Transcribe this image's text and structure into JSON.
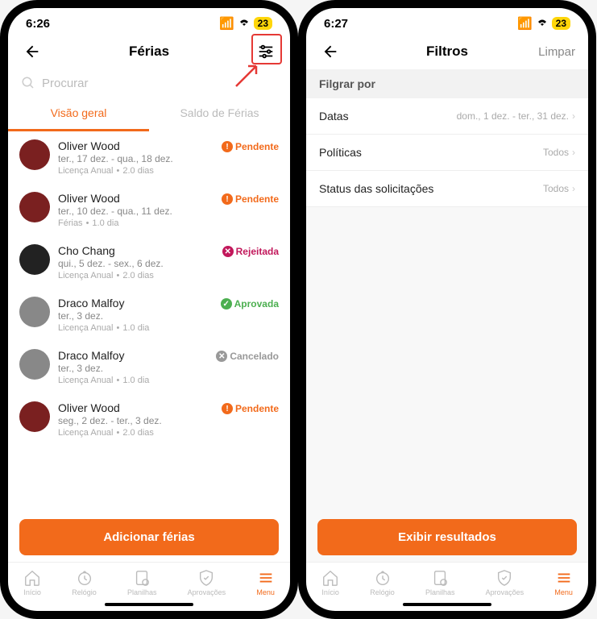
{
  "phone1": {
    "status": {
      "time": "6:26",
      "battery": "23"
    },
    "header": {
      "title": "Férias"
    },
    "search": {
      "placeholder": "Procurar"
    },
    "tabs": {
      "overview": "Visão geral",
      "balance": "Saldo de Férias"
    },
    "items": [
      {
        "name": "Oliver Wood",
        "dates": "ter., 17 dez. - qua., 18 dez.",
        "type": "Licença Anual",
        "duration": "2.0 dias",
        "status_label": "Pendente",
        "status_class": "pendente",
        "status_glyph": "!",
        "avatar_class": ""
      },
      {
        "name": "Oliver Wood",
        "dates": "ter., 10 dez. - qua., 11 dez.",
        "type": "Férias",
        "duration": "1.0 dia",
        "status_label": "Pendente",
        "status_class": "pendente",
        "status_glyph": "!",
        "avatar_class": ""
      },
      {
        "name": "Cho Chang",
        "dates": "qui., 5 dez. - sex., 6 dez.",
        "type": "Licença Anual",
        "duration": "2.0 dias",
        "status_label": "Rejeitada",
        "status_class": "rejeitada",
        "status_glyph": "✕",
        "avatar_class": "dark"
      },
      {
        "name": "Draco Malfoy",
        "dates": "ter., 3 dez.",
        "type": "Licença Anual",
        "duration": "1.0 dia",
        "status_label": "Aprovada",
        "status_class": "aprovada",
        "status_glyph": "✓",
        "avatar_class": "grey"
      },
      {
        "name": "Draco Malfoy",
        "dates": "ter., 3 dez.",
        "type": "Licença Anual",
        "duration": "1.0 dia",
        "status_label": "Cancelado",
        "status_class": "cancelado",
        "status_glyph": "✕",
        "avatar_class": "grey"
      },
      {
        "name": "Oliver Wood",
        "dates": "seg., 2 dez. - ter., 3 dez.",
        "type": "Licença Anual",
        "duration": "2.0 dias",
        "status_label": "Pendente",
        "status_class": "pendente",
        "status_glyph": "!",
        "avatar_class": ""
      }
    ],
    "add_button": "Adicionar férias",
    "nav": [
      {
        "label": "Início",
        "icon": "home-icon"
      },
      {
        "label": "Relógio",
        "icon": "clock-icon"
      },
      {
        "label": "Planilhas",
        "icon": "sheets-icon"
      },
      {
        "label": "Aprovações",
        "icon": "approvals-icon"
      },
      {
        "label": "Menu",
        "icon": "menu-icon"
      }
    ]
  },
  "phone2": {
    "status": {
      "time": "6:27",
      "battery": "23"
    },
    "header": {
      "title": "Filtros",
      "clear": "Limpar"
    },
    "section_header": "Filgrar por",
    "filters": [
      {
        "label": "Datas",
        "value": "dom., 1 dez. - ter., 31 dez."
      },
      {
        "label": "Políticas",
        "value": "Todos"
      },
      {
        "label": "Status das solicitações",
        "value": "Todos"
      }
    ],
    "show_button": "Exibir resultados",
    "nav": [
      {
        "label": "Início",
        "icon": "home-icon"
      },
      {
        "label": "Relógio",
        "icon": "clock-icon"
      },
      {
        "label": "Planilhas",
        "icon": "sheets-icon"
      },
      {
        "label": "Aprovações",
        "icon": "approvals-icon"
      },
      {
        "label": "Menu",
        "icon": "menu-icon"
      }
    ]
  }
}
